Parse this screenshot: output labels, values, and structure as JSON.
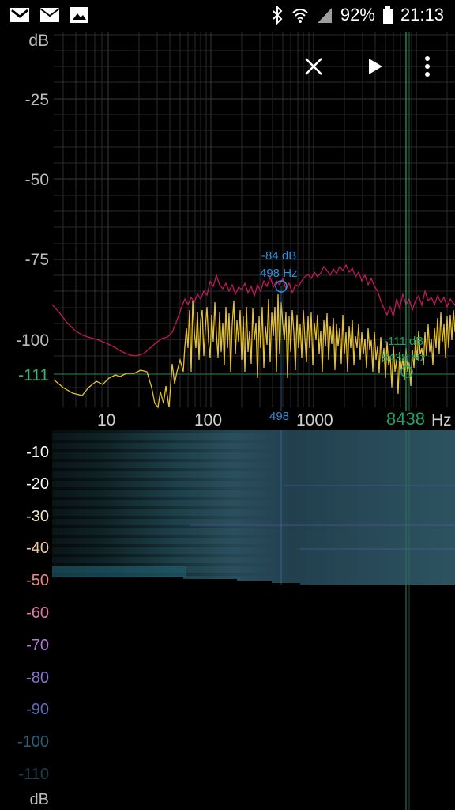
{
  "status_bar": {
    "left_icons": [
      "gmail-icon",
      "mail-icon",
      "image-icon"
    ],
    "right_icons": [
      "bluetooth-icon",
      "wifi-icon",
      "signal-icon",
      "battery-icon"
    ],
    "battery": "92%",
    "time": "21:13"
  },
  "toolbar": {
    "close": "close-icon",
    "play": "play-icon",
    "menu": "more-vert-icon"
  },
  "spectrum": {
    "y_unit": "dB",
    "y_ticks": [
      "-25",
      "-50",
      "-75",
      "-100"
    ],
    "noise_level": "-111",
    "x_ticks": [
      "10",
      "100",
      "1000"
    ],
    "x_unit_partial": "Hz",
    "peak_marker": {
      "db": "-84 dB",
      "freq": "498 Hz",
      "axis": "498"
    },
    "cursor_marker": {
      "db": "-111 dB",
      "freq": "8438 Hz",
      "axis": "8438"
    }
  },
  "spectrogram": {
    "db_ticks": [
      "-10",
      "-20",
      "-30",
      "-40",
      "-50",
      "-60",
      "-70",
      "-80",
      "-90",
      "-100",
      "-110"
    ],
    "unit": "dB"
  },
  "colors": {
    "background": "#000000",
    "peak_line": "#c2185b",
    "current_line": "#e6c229",
    "peak_marker": "#2f8fd6",
    "cursor_marker": "#1fa36b"
  }
}
